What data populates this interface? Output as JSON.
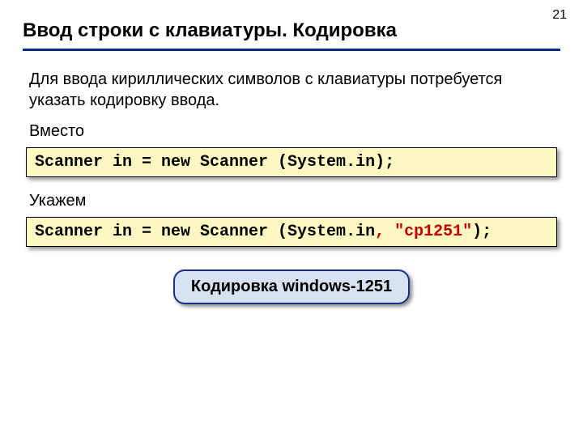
{
  "pageNumber": "21",
  "title": "Ввод строки с клавиатуры. Кодировка",
  "intro": "Для ввода кириллических символов с клавиатуры потребуется указать кодировку ввода.",
  "label1": "Вместо",
  "code1": "Scanner in = new Scanner (System.in);",
  "label2": "Укажем",
  "code2_a": "Scanner in = new Scanner (System.in",
  "code2_b": ", \"cp1251\"",
  "code2_c": ");",
  "callout": "Кодировка windows-1251"
}
